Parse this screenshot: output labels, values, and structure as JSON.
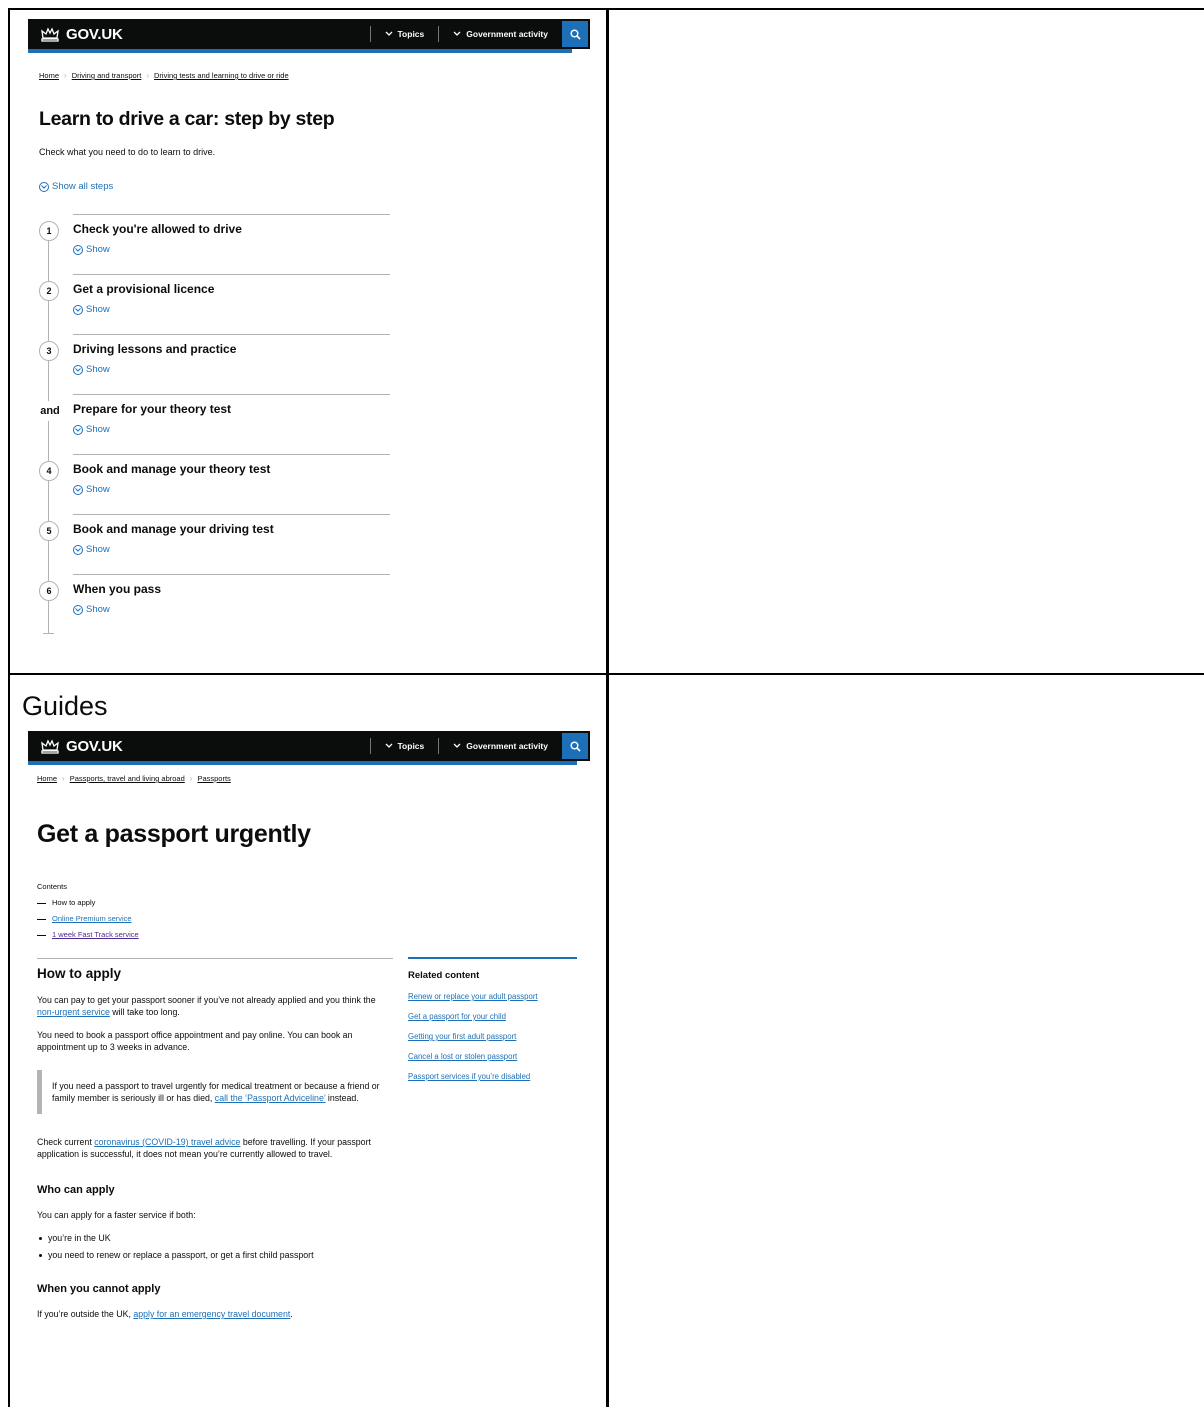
{
  "panel1": {
    "header": {
      "logo_text": "GOV.UK",
      "nav": [
        {
          "label": "Topics"
        },
        {
          "label": "Government activity"
        }
      ],
      "search_icon": "search-icon"
    },
    "breadcrumb": [
      "Home",
      "Driving and transport",
      "Driving tests and learning to drive or ride"
    ],
    "title": "Learn to drive a car: step by step",
    "lead": "Check what you need to do to learn to drive.",
    "show_all": "Show all steps",
    "steps": [
      {
        "num": "1",
        "title": "Check you're allowed to drive",
        "show": "Show"
      },
      {
        "num": "2",
        "title": "Get a provisional licence",
        "show": "Show"
      },
      {
        "num": "3",
        "title": "Driving lessons and practice",
        "show": "Show"
      },
      {
        "num": "and",
        "title": "Prepare for your theory test",
        "show": "Show"
      },
      {
        "num": "4",
        "title": "Book and manage your theory test",
        "show": "Show"
      },
      {
        "num": "5",
        "title": "Book and manage your driving test",
        "show": "Show"
      },
      {
        "num": "6",
        "title": "When you pass",
        "show": "Show"
      }
    ]
  },
  "section_label": "Guides",
  "panel2": {
    "header": {
      "logo_text": "GOV.UK",
      "nav": [
        {
          "label": "Topics"
        },
        {
          "label": "Government activity"
        }
      ]
    },
    "breadcrumb": [
      "Home",
      "Passports, travel and living abroad",
      "Passports"
    ],
    "title": "Get a passport urgently",
    "contents": {
      "heading": "Contents",
      "items": [
        "How to apply",
        "Online Premium service",
        "1 week Fast Track service"
      ]
    },
    "how_to_apply": {
      "heading": "How to apply",
      "p1_a": "You can pay to get your passport sooner if you’ve not already applied and you think the ",
      "p1_link": "non-urgent service",
      "p1_b": " will take too long.",
      "p2": "You need to book a passport office appointment and pay online. You can book an appointment up to 3 weeks in advance.",
      "inset_a": "If you need a passport to travel urgently for medical treatment or because a friend or family member is seriously ill or has died, ",
      "inset_link": "call the ‘Passport Adviceline’",
      "inset_b": " instead.",
      "p3_a": "Check current ",
      "p3_link": "coronavirus (COVID-19) travel advice",
      "p3_b": " before travelling. If your passport application is successful, it does not mean you’re currently allowed to travel."
    },
    "who_can_apply": {
      "heading": "Who can apply",
      "intro": "You can apply for a faster service if both:",
      "bullets": [
        "you’re in the UK",
        "you need to renew or replace a passport, or get a first child passport"
      ]
    },
    "cannot_apply": {
      "heading": "When you cannot apply",
      "text_a": "If you’re outside the UK, ",
      "link": "apply for an emergency travel document",
      "text_b": "."
    },
    "related": {
      "heading": "Related content",
      "links": [
        "Renew or replace your adult passport",
        "Get a passport for your child",
        "Getting your first adult passport",
        "Cancel a lost or stolen passport",
        "Passport services if you’re disabled"
      ]
    }
  },
  "colors": {
    "brand_black": "#0b0c0c",
    "link_blue": "#1d70b8",
    "visited_purple": "#4c2c92",
    "rule_grey": "#b1b4b6"
  }
}
